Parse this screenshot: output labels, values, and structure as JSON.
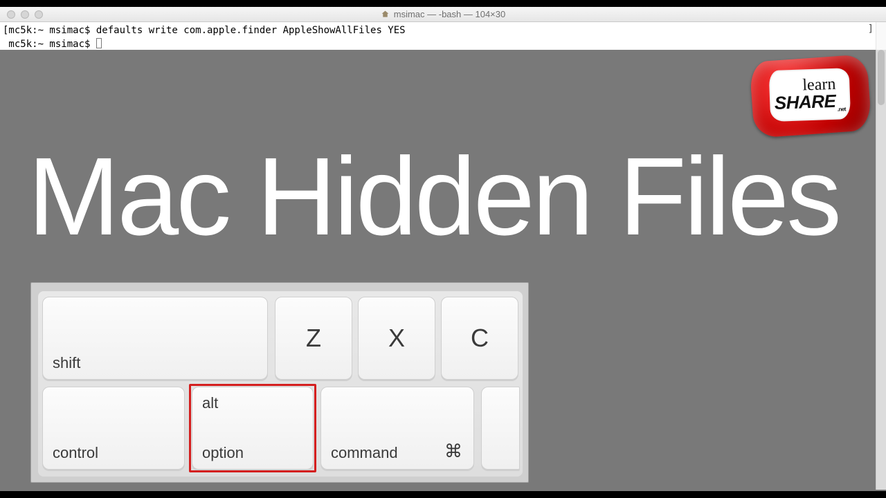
{
  "window": {
    "title": "msimac — -bash — 104×30"
  },
  "terminal": {
    "line1_prompt": "[mc5k:~ msimac$ ",
    "line1_cmd": "defaults write com.apple.finder AppleShowAllFiles YES",
    "line2_prompt": " mc5k:~ msimac$ "
  },
  "headline": "Mac Hidden Files",
  "logo": {
    "line1": "learn",
    "line2": "SHARE",
    "suffix": ".net"
  },
  "keyboard": {
    "shift": "shift",
    "z": "Z",
    "x": "X",
    "c": "C",
    "control": "control",
    "alt_top": "alt",
    "alt_bottom": "option",
    "command": "command",
    "command_symbol": "⌘"
  }
}
